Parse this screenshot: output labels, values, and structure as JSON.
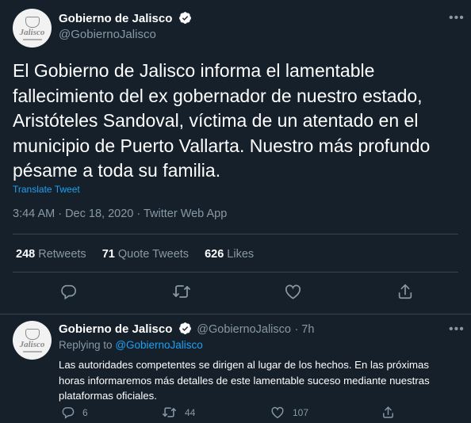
{
  "main": {
    "account_name": "Gobierno de Jalisco",
    "account_handle": "@GobiernoJalisco",
    "avatar_text": "Jalisco",
    "text": "El Gobierno de Jalisco informa el lamentable fallecimiento del ex gobernador de nuestro estado, Aristóteles Sandoval, víctima de un atentado en el municipio de Puerto Vallarta. Nuestro más profundo pésame a toda su familia.",
    "translate_label": "Translate Tweet",
    "meta": "3:44 AM · Dec 18, 2020 · Twitter Web App",
    "retweets_count": "248",
    "retweets_label": "Retweets",
    "quotes_count": "71",
    "quotes_label": "Quote Tweets",
    "likes_count": "626",
    "likes_label": "Likes"
  },
  "reply": {
    "account_name": "Gobierno de Jalisco",
    "account_handle": "@GobiernoJalisco",
    "time": "· 7h",
    "avatar_text": "Jalisco",
    "replying_prefix": "Replying to",
    "replying_handle": "@GobiernoJalisco",
    "text": "Las autoridades competentes se dirigen al lugar de los hechos. En las próximas horas informaremos más detalles de este lamentable suceso mediante nuestras plataformas oficiales.",
    "reply_count": "6",
    "retweet_count": "44",
    "like_count": "107"
  },
  "colors": {
    "background": "#15202b",
    "accent": "#1da1f2",
    "secondary_text": "#8899a6",
    "divider": "#38444d"
  },
  "icons": [
    "verified-badge-icon",
    "more-icon",
    "reply-icon",
    "retweet-icon",
    "like-icon",
    "share-icon"
  ]
}
